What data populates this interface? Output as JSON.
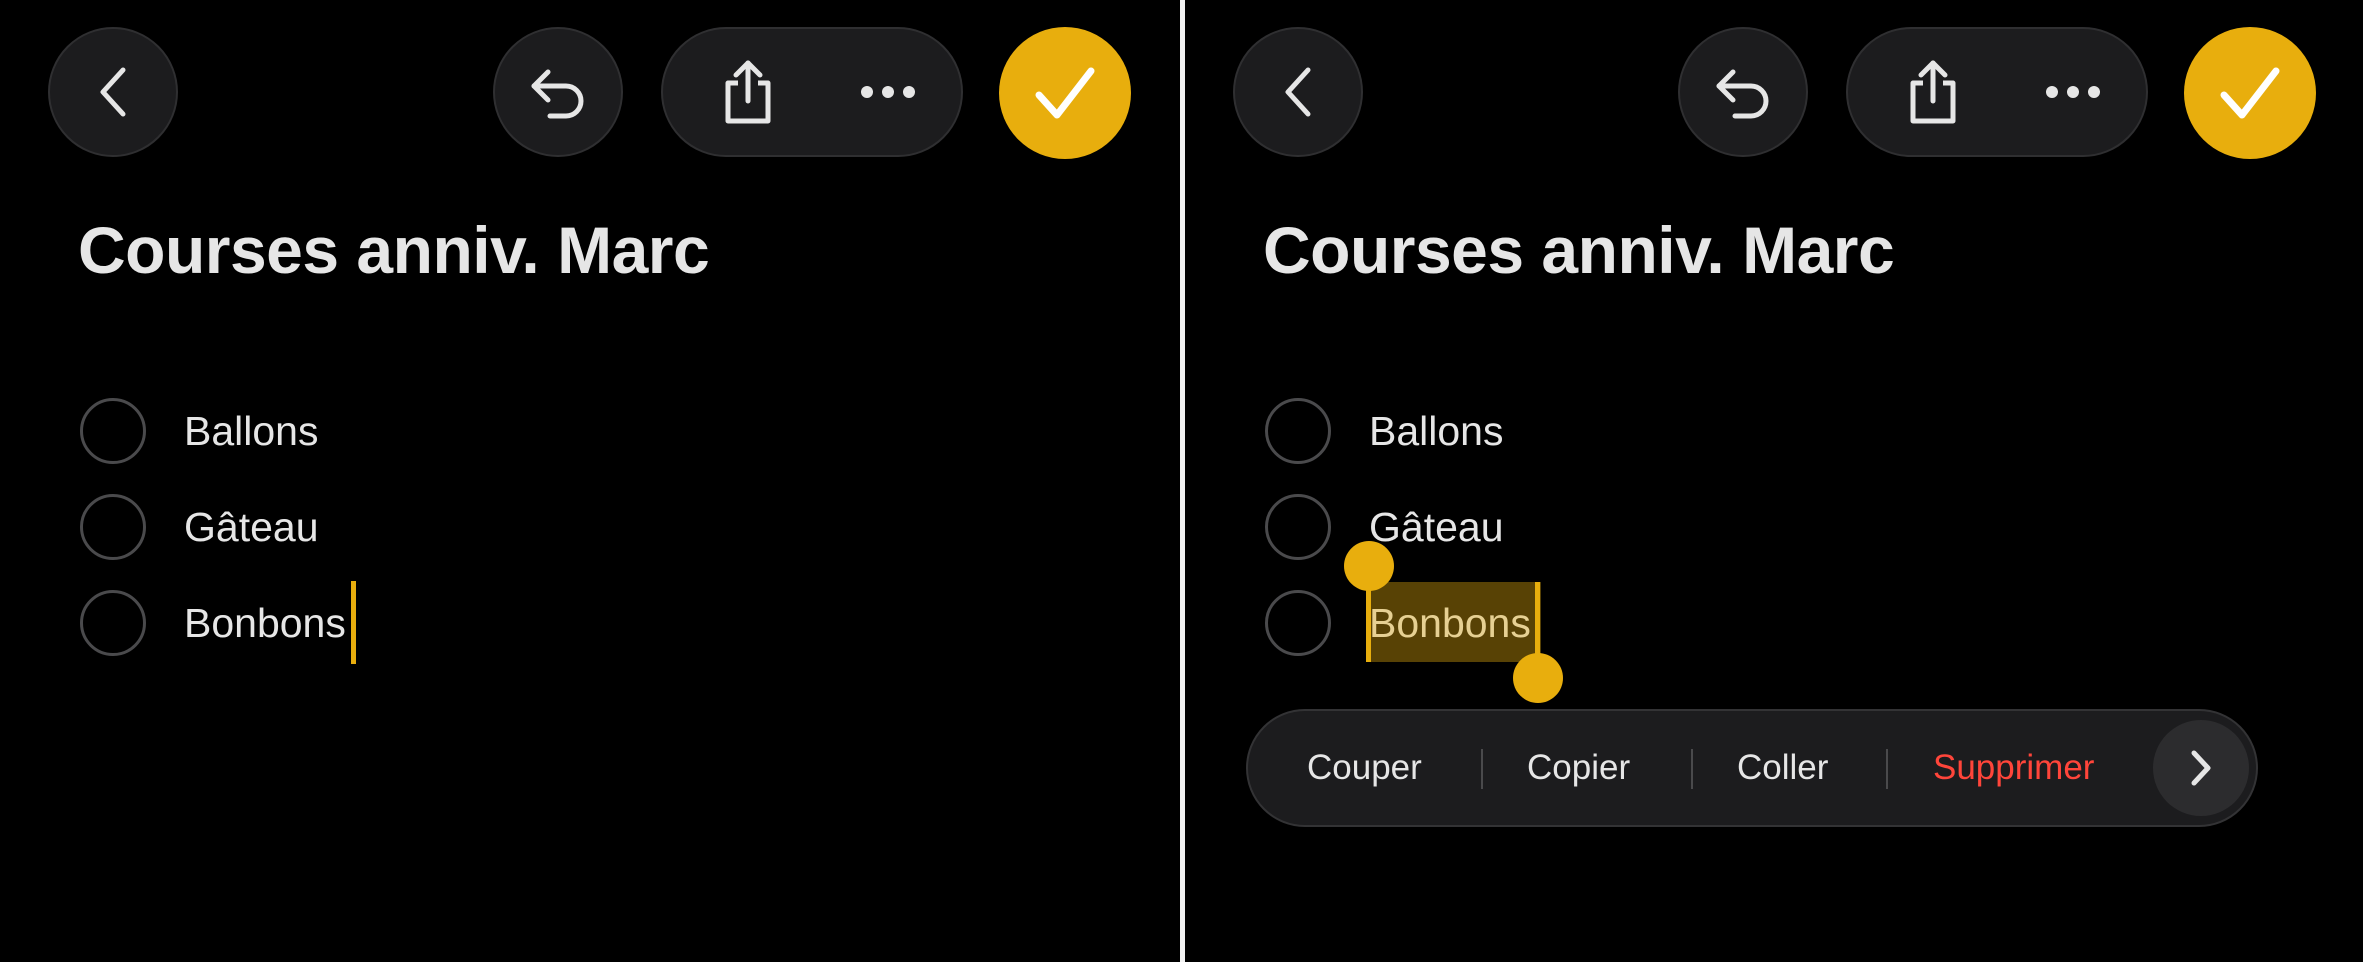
{
  "note": {
    "title": "Courses anniv. Marc",
    "items": [
      {
        "label": "Ballons",
        "checked": false
      },
      {
        "label": "Gâteau",
        "checked": false
      },
      {
        "label": "Bonbons",
        "checked": false
      }
    ]
  },
  "toolbar": {
    "back_icon": "chevron-left-icon",
    "undo_icon": "undo-arrow-icon",
    "share_icon": "share-icon",
    "more_icon": "ellipsis-icon",
    "done_icon": "checkmark-icon"
  },
  "edit_menu": {
    "cut_label": "Couper",
    "copy_label": "Copier",
    "paste_label": "Coller",
    "delete_label": "Supprimer",
    "next_icon": "chevron-right-icon"
  },
  "colors": {
    "accent": "#e8ae0d",
    "destructive": "#ff453a",
    "background": "#000000",
    "control": "#1c1c1e"
  }
}
